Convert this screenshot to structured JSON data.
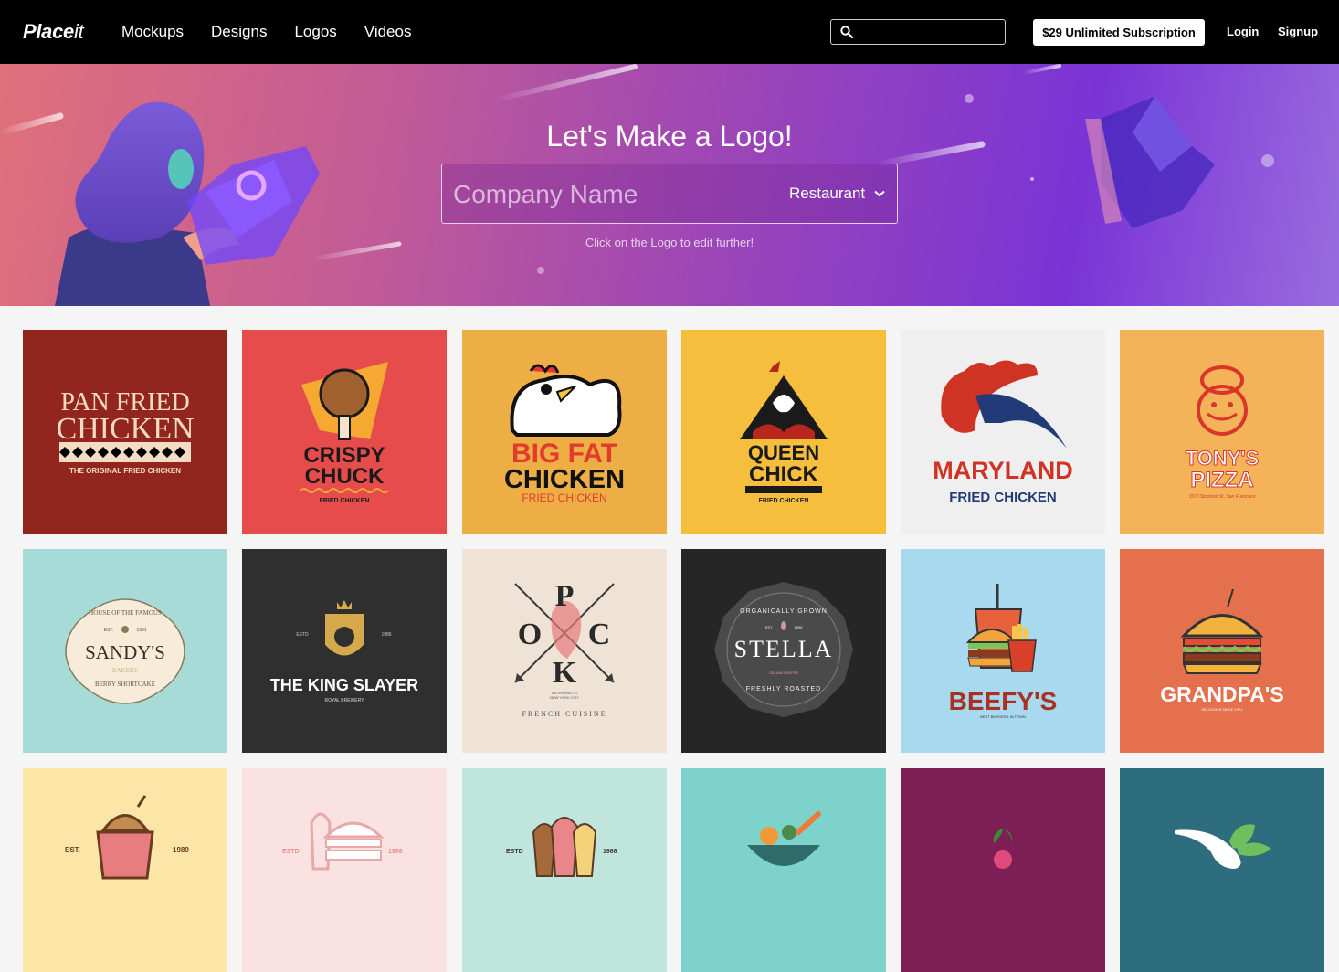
{
  "nav": {
    "brand_bold": "Place",
    "brand_italic": "it",
    "links": [
      "Mockups",
      "Designs",
      "Logos",
      "Videos"
    ],
    "subscription": "$29 Unlimited Subscription",
    "login": "Login",
    "signup": "Signup"
  },
  "hero": {
    "title": "Let's Make a Logo!",
    "placeholder": "Company Name",
    "category": "Restaurant",
    "hint": "Click on the Logo to edit further!"
  },
  "tiles": [
    {
      "bg": "#93251f",
      "lines": [
        "PAN FRIED",
        "CHICKEN",
        "THE ORIGINAL FRIED CHICKEN"
      ]
    },
    {
      "bg": "#e64c4c",
      "lines": [
        "CRISPY",
        "CHUCK",
        "FRIED CHICKEN"
      ]
    },
    {
      "bg": "#eeae46",
      "lines": [
        "BIG FAT",
        "CHICKEN",
        "FRIED CHICKEN"
      ]
    },
    {
      "bg": "#f5be3d",
      "lines": [
        "QUEEN",
        "CHICK",
        "FRIED CHICKEN"
      ]
    },
    {
      "bg": "#efefef",
      "lines": [
        "MARYLAND",
        "FRIED CHICKEN"
      ]
    },
    {
      "bg": "#f4b359",
      "lines": [
        "TONY'S",
        "PIZZA",
        "1570 Stockton St. San Francisco"
      ]
    },
    {
      "bg": "#a6dbd7",
      "lines": [
        "HOUSE OF THE FAMOUS",
        "EST.",
        "1991",
        "SANDY'S",
        "BAKERY",
        "BERRY SHORTCAKE"
      ]
    },
    {
      "bg": "#2f2f2f",
      "lines": [
        "ESTD",
        "1986",
        "THE KING SLAYER",
        "ROYAL BREWERY"
      ]
    },
    {
      "bg": "#eee3d5",
      "lines": [
        "P",
        "O",
        "C",
        "K",
        "158 SPRING ST.",
        "NEW YORK CITY",
        "FRENCH CUISINE"
      ]
    },
    {
      "bg": "#262626",
      "lines": [
        "ORGANICALLY GROWN",
        "EST.",
        "1996",
        "STELLA",
        "ITALIAN COFFEE",
        "FRESHLY ROASTED"
      ]
    },
    {
      "bg": "#a8d9ef",
      "lines": [
        "BEEFY'S",
        "BEST BURGERS IN TOWN"
      ]
    },
    {
      "bg": "#e4704d",
      "lines": [
        "GRANDPA'S",
        "DELICIOUS SINCE 1971"
      ]
    },
    {
      "bg": "#fbe6a8",
      "lines": [
        "EST.",
        "1989"
      ]
    },
    {
      "bg": "#fbe2e2",
      "lines": [
        "ESTD",
        "1986"
      ]
    },
    {
      "bg": "#bfe5dc",
      "lines": [
        "ESTD",
        "1986"
      ]
    },
    {
      "bg": "#7dd3cc",
      "lines": []
    },
    {
      "bg": "#7d1e55",
      "lines": []
    },
    {
      "bg": "#2d6d7d",
      "lines": []
    }
  ]
}
